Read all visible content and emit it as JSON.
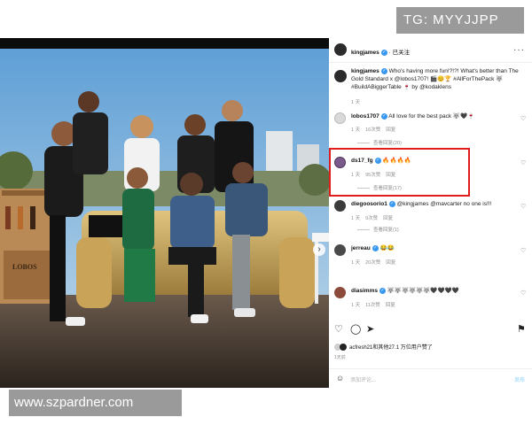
{
  "watermarks": {
    "top": "TG: MYYJJPP",
    "bottom": "www.szpardner.com"
  },
  "post": {
    "author": "kingjames",
    "follow_status": "· 已关注",
    "caption_user": "kingjames",
    "caption": "Who's having more fun!?!?! What's better than The Gold Standard x @lobos1707! 🎬😊🏆 #AllForThePack 🐺 #BuildABiggerTable 🍷 by @kodaklens",
    "caption_time": "1 天",
    "bottle_brand": "LOBOS",
    "likes_text": "acfresh21和其他27.1 万位用户赞了",
    "date": "1天前",
    "add_comment_placeholder": "添加评论...",
    "post_button": "发布"
  },
  "comments": [
    {
      "user": "lobos1707",
      "verified": true,
      "text": "All love for the best pack 🐺🖤🍷",
      "time": "1 天",
      "likes": "16次赞",
      "reply": "回复",
      "view_replies": "查看回复(20)"
    },
    {
      "user": "ds17_fg",
      "verified": true,
      "text": "🔥🔥🔥🔥",
      "time": "1 天",
      "likes": "95次赞",
      "reply": "回复",
      "view_replies": "查看回复(17)"
    },
    {
      "user": "diegoosorio1",
      "verified": true,
      "text": "@kingjames @mavcarter no one is!!!",
      "time": "1 天",
      "likes": "9次赞",
      "reply": "回复",
      "view_replies": "查看回复(1)"
    },
    {
      "user": "jerreau",
      "verified": true,
      "text": "😂😂",
      "time": "1 天",
      "likes": "20次赞",
      "reply": "回复",
      "view_replies": ""
    },
    {
      "user": "diasimms",
      "verified": true,
      "text": "🐺🐺🐺🐺🐺🐺🖤🖤🖤🖤",
      "time": "1 天",
      "likes": "11次赞",
      "reply": "回复",
      "view_replies": ""
    }
  ],
  "colors": {
    "highlight": "#e01c1c",
    "verified": "#3897f0",
    "sky_top": "#5f9fd6",
    "sky_bottom": "#bcd8ea",
    "gold": "#c9a458"
  }
}
